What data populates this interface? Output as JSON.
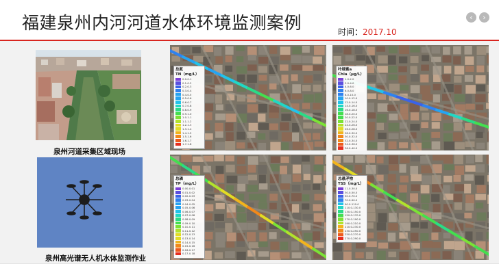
{
  "page": {
    "title": "福建泉州内河河道水体环境监测案例",
    "time_label": "时间：",
    "time_value": "2017.10"
  },
  "photos": {
    "river_caption": "泉州河道采集区域现场",
    "drone_caption": "泉州高光谱无人机水体监测作业"
  },
  "colors": {
    "accent": "#d8251f",
    "legend_scale": [
      "#7b3fd6",
      "#5b4fe0",
      "#3b63e8",
      "#2f82f0",
      "#26a4f2",
      "#22c3ea",
      "#21d8c4",
      "#2bdb86",
      "#44de4f",
      "#7be236",
      "#b2e22c",
      "#e2dc24",
      "#f2b41c",
      "#f2881a",
      "#ee5a1c",
      "#e52d1e"
    ]
  },
  "maps": [
    {
      "key": "tn",
      "legend_title": "总氮",
      "legend_subtitle": "TN（mg/L）",
      "ranges": [
        "0.0-0.1",
        "0.1-0.2",
        "0.2-0.3",
        "0.3-0.4",
        "0.4-0.5",
        "0.5-0.6",
        "0.6-0.7",
        "0.7-0.8",
        "0.8-0.9",
        "0.9-1.0",
        "1.0-1.1",
        "1.1-1.2",
        "1.2-1.3",
        "1.3-1.4",
        "1.4-1.5",
        "1.5-1.6",
        "1.6-1.7",
        "1.7-1.8"
      ]
    },
    {
      "key": "chla",
      "legend_title": "叶绿素a",
      "legend_subtitle": "Chla（μg/L）",
      "ranges": [
        "1.0-2.0",
        "2.0-4.0",
        "4.0-6.0",
        "6.0-8.0",
        "8.0-10.0",
        "10.0-12.0",
        "12.0-14.0",
        "14.0-16.0",
        "16.0-18.0",
        "18.0-20.0",
        "20.0-22.0",
        "22.0-24.0",
        "24.0-26.0",
        "26.0-28.0",
        "28.0-30.0",
        "30.0-32.0",
        "32.0-34.0",
        "34.0-36.0",
        "36.0-40.0"
      ]
    },
    {
      "key": "tp",
      "legend_title": "总磷",
      "legend_subtitle": "TP（mg/L）",
      "ranges": [
        "0.00-0.01",
        "0.01-0.02",
        "0.02-0.03",
        "0.03-0.04",
        "0.04-0.05",
        "0.05-0.06",
        "0.06-0.07",
        "0.07-0.08",
        "0.08-0.09",
        "0.09-0.10",
        "0.10-0.11",
        "0.11-0.12",
        "0.12-0.13",
        "0.13-0.14",
        "0.14-0.15",
        "0.15-0.16",
        "0.16-0.17",
        "0.17-0.18"
      ]
    },
    {
      "key": "tss",
      "legend_title": "总悬浮物",
      "legend_subtitle": "TSS（mg/L）",
      "ranges": [
        "11.0-30.0",
        "30.0-50.0",
        "50.0-70.0",
        "70.0-90.0",
        "90.0-110.0",
        "110.0-130.0",
        "130.0-150.0",
        "150.0-170.0",
        "170.0-190.0",
        "190.0-210.0",
        "210.0-230.0",
        "230.0-250.0",
        "250.0-270.0",
        "270.0-290.0"
      ]
    }
  ]
}
